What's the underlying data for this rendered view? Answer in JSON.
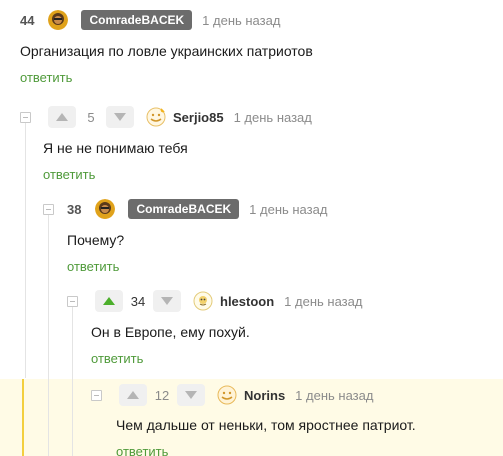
{
  "comments": [
    {
      "rating": "44",
      "user": "ComradeBACEK",
      "time": "1 день назад",
      "text": "Организация по ловле украинских патриотов",
      "reply_label": "ответить"
    },
    {
      "rating": "5",
      "user": "Serjio85",
      "time": "1 день назад",
      "text": "Я не не понимаю тебя",
      "reply_label": "ответить"
    },
    {
      "rating": "38",
      "user": "ComradeBACEK",
      "time": "1 день назад",
      "text": "Почему?",
      "reply_label": "ответить"
    },
    {
      "rating": "34",
      "user": "hlestoon",
      "time": "1 день назад",
      "text": "Он в Европе, ему похуй.",
      "reply_label": "ответить"
    },
    {
      "rating": "12",
      "user": "Norins",
      "time": "1 день назад",
      "text": "Чем дальше от неньки, том яростнее патриот.",
      "reply_label": "ответить"
    }
  ],
  "colors": {
    "reply_link": "#4f9a3a",
    "upvoted_arrow": "#4caf2b",
    "highlight_bg": "#fffbe6",
    "highlight_border": "#f3cf3e"
  },
  "icons": {
    "collapse": "minus-square-icon",
    "upvote": "arrow-up-icon",
    "downvote": "arrow-down-icon"
  }
}
